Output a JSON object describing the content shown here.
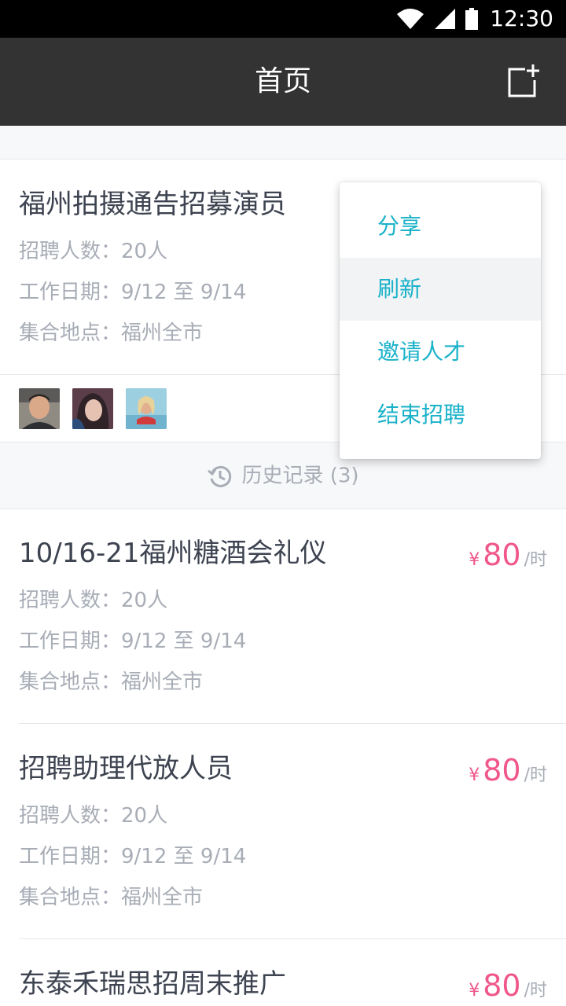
{
  "status_bar": {
    "time": "12:30",
    "icons": [
      "wifi-icon",
      "signal-icon",
      "battery-icon"
    ]
  },
  "app_bar": {
    "title": "首页",
    "action_icon": "add-document-icon"
  },
  "first_card": {
    "title": "福州拍摄通告招募演员",
    "headcount": "招聘人数：20人",
    "dates": "工作日期：9/12 至 9/14",
    "location": "集合地点：福州全市",
    "avatars": [
      "avatar-man",
      "avatar-woman",
      "avatar-beach"
    ]
  },
  "history": {
    "label": "历史记录 (3)",
    "icon": "history-clock-icon"
  },
  "jobs": [
    {
      "title": "10/16-21福州糖酒会礼仪",
      "headcount": "招聘人数：20人",
      "dates": "工作日期：9/12 至 9/14",
      "location": "集合地点：福州全市",
      "currency": "¥",
      "price": "80",
      "unit": "/时"
    },
    {
      "title": "招聘助理代放人员",
      "headcount": "招聘人数：20人",
      "dates": "工作日期：9/12 至 9/14",
      "location": "集合地点：福州全市",
      "currency": "¥",
      "price": "80",
      "unit": "/时"
    },
    {
      "title": "东泰禾瑞思招周末推广",
      "currency": "¥",
      "price": "80",
      "unit": "/时"
    }
  ],
  "menu": {
    "items": [
      {
        "label": "分享"
      },
      {
        "label": "刷新"
      },
      {
        "label": "邀请人才"
      },
      {
        "label": "结束招聘"
      }
    ]
  },
  "colors": {
    "accent": "#1ab2c9",
    "price": "#f0578b",
    "appbar": "#333333"
  }
}
